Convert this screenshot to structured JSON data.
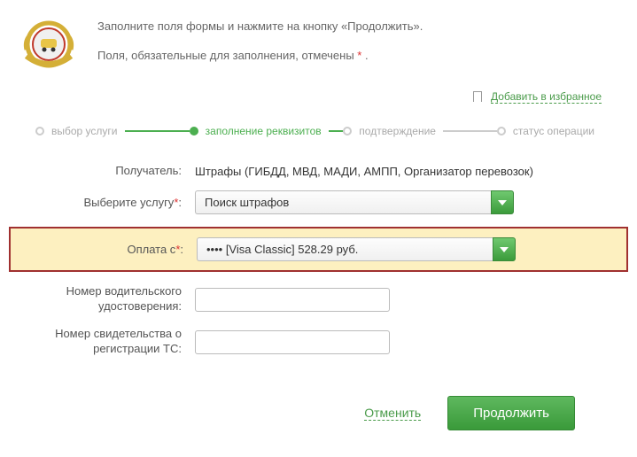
{
  "instructions": {
    "line1": "Заполните поля формы и нажмите на кнопку «Продолжить».",
    "line2_prefix": "Поля, обязательные для заполнения, отмечены ",
    "line2_marker": "*",
    "line2_suffix": " ."
  },
  "favorites": {
    "link_label": "Добавить в избранное"
  },
  "steps": {
    "s1": "выбор услуги",
    "s2": "заполнение реквизитов",
    "s3": "подтверждение",
    "s4": "статус операции"
  },
  "form": {
    "recipient_label": "Получатель:",
    "recipient_value": "Штрафы (ГИБДД, МВД, МАДИ, АМПП, Организатор перевозок)",
    "service_label": "Выберите услугу",
    "service_value": "Поиск штрафов",
    "payfrom_label": "Оплата с",
    "payfrom_value": "••••         [Visa Classic] 528.29 руб.",
    "driver_license_label": "Номер водительского удостоверения:",
    "driver_license_value": "",
    "vehicle_reg_label": "Номер свидетельства о регистрации ТС:",
    "vehicle_reg_value": ""
  },
  "actions": {
    "cancel": "Отменить",
    "continue": "Продолжить"
  }
}
